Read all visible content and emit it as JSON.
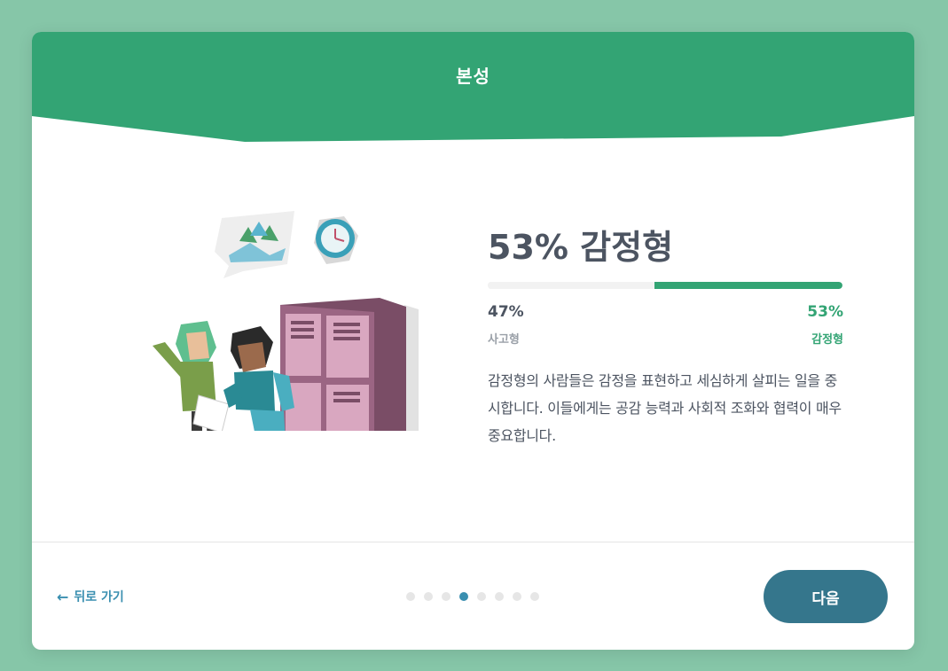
{
  "header": {
    "title": "본성"
  },
  "result": {
    "title": "53% 감정형",
    "left": {
      "percent_label": "47%",
      "trait": "사고형",
      "value": 0.47
    },
    "right": {
      "percent_label": "53%",
      "trait": "감정형",
      "value": 0.53
    },
    "description": "감정형의 사람들은 감정을 표현하고 세심하게 살피는 일을 중시합니다. 이들에게는 공감 능력과 사회적 조화와 협력이 매우 중요합니다."
  },
  "footer": {
    "back_label": "뒤로 가기",
    "next_label": "다음",
    "pagination": {
      "total": 8,
      "current": 4
    }
  },
  "colors": {
    "background": "#86c6a8",
    "header": "#33a474",
    "accent": "#33a474",
    "link": "#3a8fb0",
    "next_button": "#35768c"
  },
  "icons": {
    "back": "arrow-left-icon"
  }
}
